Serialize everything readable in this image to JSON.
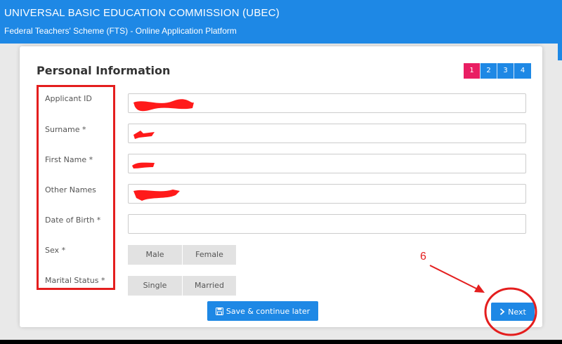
{
  "header": {
    "org_title": "UNIVERSAL BASIC EDUCATION COMMISSION (UBEC)",
    "platform_title": "Federal Teachers' Scheme (FTS) - Online Application Platform"
  },
  "form": {
    "title": "Personal Information",
    "steps": [
      "1",
      "2",
      "3",
      "4"
    ],
    "active_step": "1",
    "labels": {
      "applicant_id": "Applicant ID",
      "surname": "Surname *",
      "first_name": "First Name *",
      "other_names": "Other Names",
      "dob": "Date of Birth *",
      "sex": "Sex *",
      "marital": "Marital Status *"
    },
    "sex_options": [
      "Male",
      "Female"
    ],
    "marital_options": [
      "Single",
      "Married"
    ],
    "save_label": "Save & continue later",
    "next_label": "Next"
  },
  "annotation": {
    "step_number": "6",
    "color": "#e41e1e"
  },
  "colors": {
    "primary": "#1e88e5",
    "active_step": "#e91e63",
    "annotation": "#e41e1e"
  },
  "icons": {
    "save": "floppy-disk-icon",
    "next": "chevron-right-icon"
  }
}
